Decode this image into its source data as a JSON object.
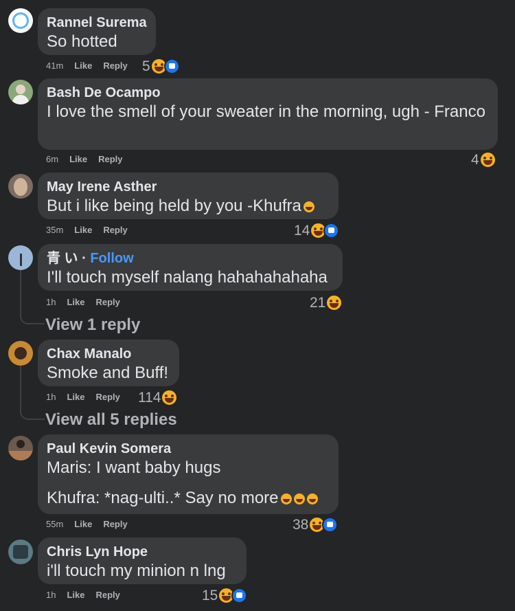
{
  "comments": [
    {
      "author": "Rannel Surema",
      "text": "So hotted",
      "time": "41m",
      "like": "Like",
      "reply": "Reply",
      "reactions": "5",
      "has_like_icon": true
    },
    {
      "author": "Bash De Ocampo",
      "text": "I love the smell of your sweater in the morning, ugh - Franco",
      "time": "6m",
      "like": "Like",
      "reply": "Reply",
      "reactions": "4",
      "has_like_icon": false
    },
    {
      "author": "May Irene Asther",
      "text": "But i like being held by you -Khufra",
      "time": "35m",
      "like": "Like",
      "reply": "Reply",
      "reactions": "14",
      "has_like_icon": true
    },
    {
      "author": "青 い",
      "follow": "Follow",
      "text": "I'll touch myself nalang hahahahahaha",
      "time": "1h",
      "like": "Like",
      "reply": "Reply",
      "reactions": "21",
      "has_like_icon": false,
      "view_replies": "View 1 reply"
    },
    {
      "author": "Chax Manalo",
      "text": "Smoke and Buff!",
      "time": "1h",
      "like": "Like",
      "reply": "Reply",
      "reactions": "114",
      "has_like_icon": false,
      "view_replies": "View all 5 replies"
    },
    {
      "author": "Paul Kevin Somera",
      "text": "Maris: I want baby hugs",
      "text2": "Khufra: *nag-ulti..* Say no more",
      "time": "55m",
      "like": "Like",
      "reply": "Reply",
      "reactions": "38",
      "has_like_icon": true
    },
    {
      "author": "Chris Lyn Hope",
      "text": "i'll touch my minion n lng",
      "time": "1h",
      "like": "Like",
      "reply": "Reply",
      "reactions": "15",
      "has_like_icon": true
    }
  ],
  "colors": {
    "background": "#242526",
    "bubble": "#3a3b3c",
    "text": "#e4e6eb",
    "muted": "#b0b3b8",
    "follow": "#4599ff"
  }
}
